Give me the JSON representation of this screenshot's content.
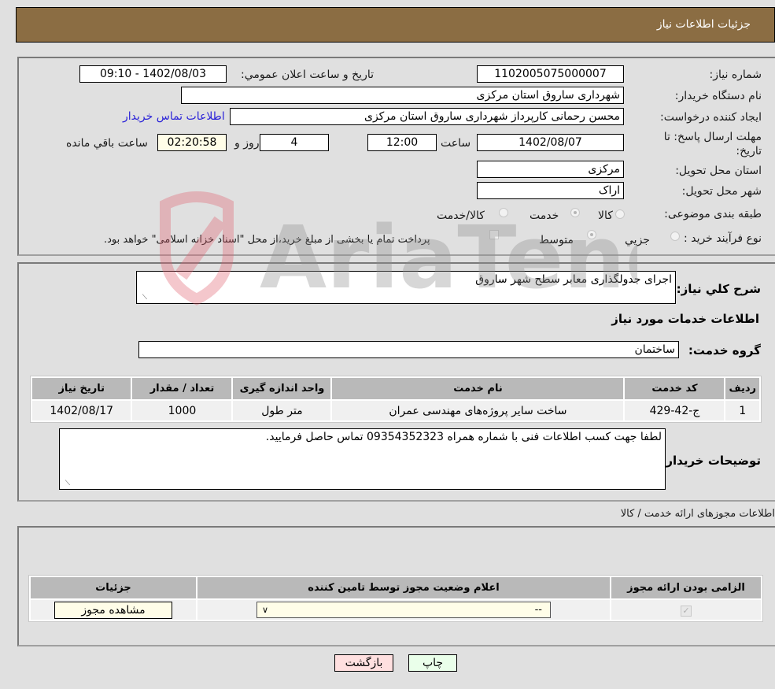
{
  "header": {
    "title": "جزئیات اطلاعات نیاز"
  },
  "form": {
    "need_number": {
      "label": "شماره نیاز:",
      "value": "1102005075000007"
    },
    "announce": {
      "label": "تاریخ و ساعت اعلان عمومي:",
      "value": "1402/08/03 - 09:10"
    },
    "buyer_org": {
      "label": "نام دستگاه خريدار:",
      "value": "شهرداری ساروق استان مرکزی"
    },
    "requester": {
      "label": "ایجاد کننده درخواست:",
      "value": "محسن  رحمانی کارپرداز شهرداری ساروق استان مرکزی"
    },
    "contact_link": "اطلاعات تماس خریدار",
    "deadline": {
      "label": "مهلت ارسال پاسخ: تا تاریخ:",
      "date": "1402/08/07",
      "time_label": "ساعت",
      "time": "12:00",
      "days": "4",
      "days_label": "روز و",
      "remaining": "02:20:58",
      "remaining_label": "ساعت باقي مانده"
    },
    "province": {
      "label": "استان محل تحویل:",
      "value": "مرکزی"
    },
    "city": {
      "label": "شهر محل تحویل:",
      "value": "اراک"
    },
    "category": {
      "label": "طبقه بندی موضوعی:",
      "options": [
        "کالا",
        "خدمت",
        "کالا/خدمت"
      ],
      "selected": "خدمت"
    },
    "process": {
      "label": "نوع فرآیند خرید :",
      "options": [
        "جزیي",
        "متوسط"
      ],
      "selected": "متوسط",
      "note": "پرداخت تمام یا بخشی از مبلغ خرید،از محل \"اسناد خزانه اسلامی\" خواهد بود."
    }
  },
  "details": {
    "summary_label": "شرح کلي نياز:",
    "summary": "اجرای جدولگذاری معابر سطح شهر ساروق",
    "services_title": "اطلاعات خدمات مورد نیاز",
    "group_label": "گروه خدمت:",
    "group_value": "ساختمان",
    "table": {
      "headers": [
        "ردیف",
        "کد خدمت",
        "نام خدمت",
        "واحد اندازه گیری",
        "تعداد / مقدار",
        "تاریخ نیاز"
      ],
      "rows": [
        [
          "1",
          "ج-42-429",
          "ساخت سایر پروژه‌های مهندسی عمران",
          "متر طول",
          "1000",
          "1402/08/17"
        ]
      ]
    },
    "buyer_notes_label": "توضیحات خریدار:",
    "buyer_notes": "لطفا جهت کسب اطلاعات فنی با شماره همراه 09354352323 تماس حاصل فرمایید."
  },
  "permits": {
    "section_title": "اطلاعات مجوزهای ارائه خدمت / کالا",
    "headers": [
      "الزامی بودن ارائه مجوز",
      "اعلام وضعیت مجوز توسط تامین کننده",
      "جزئیات"
    ],
    "row": {
      "required": true,
      "status": "--",
      "view_button": "مشاهده مجوز"
    }
  },
  "footer": {
    "print": "چاپ",
    "back": "بازگشت"
  },
  "watermark": "AriaTender.neT"
}
